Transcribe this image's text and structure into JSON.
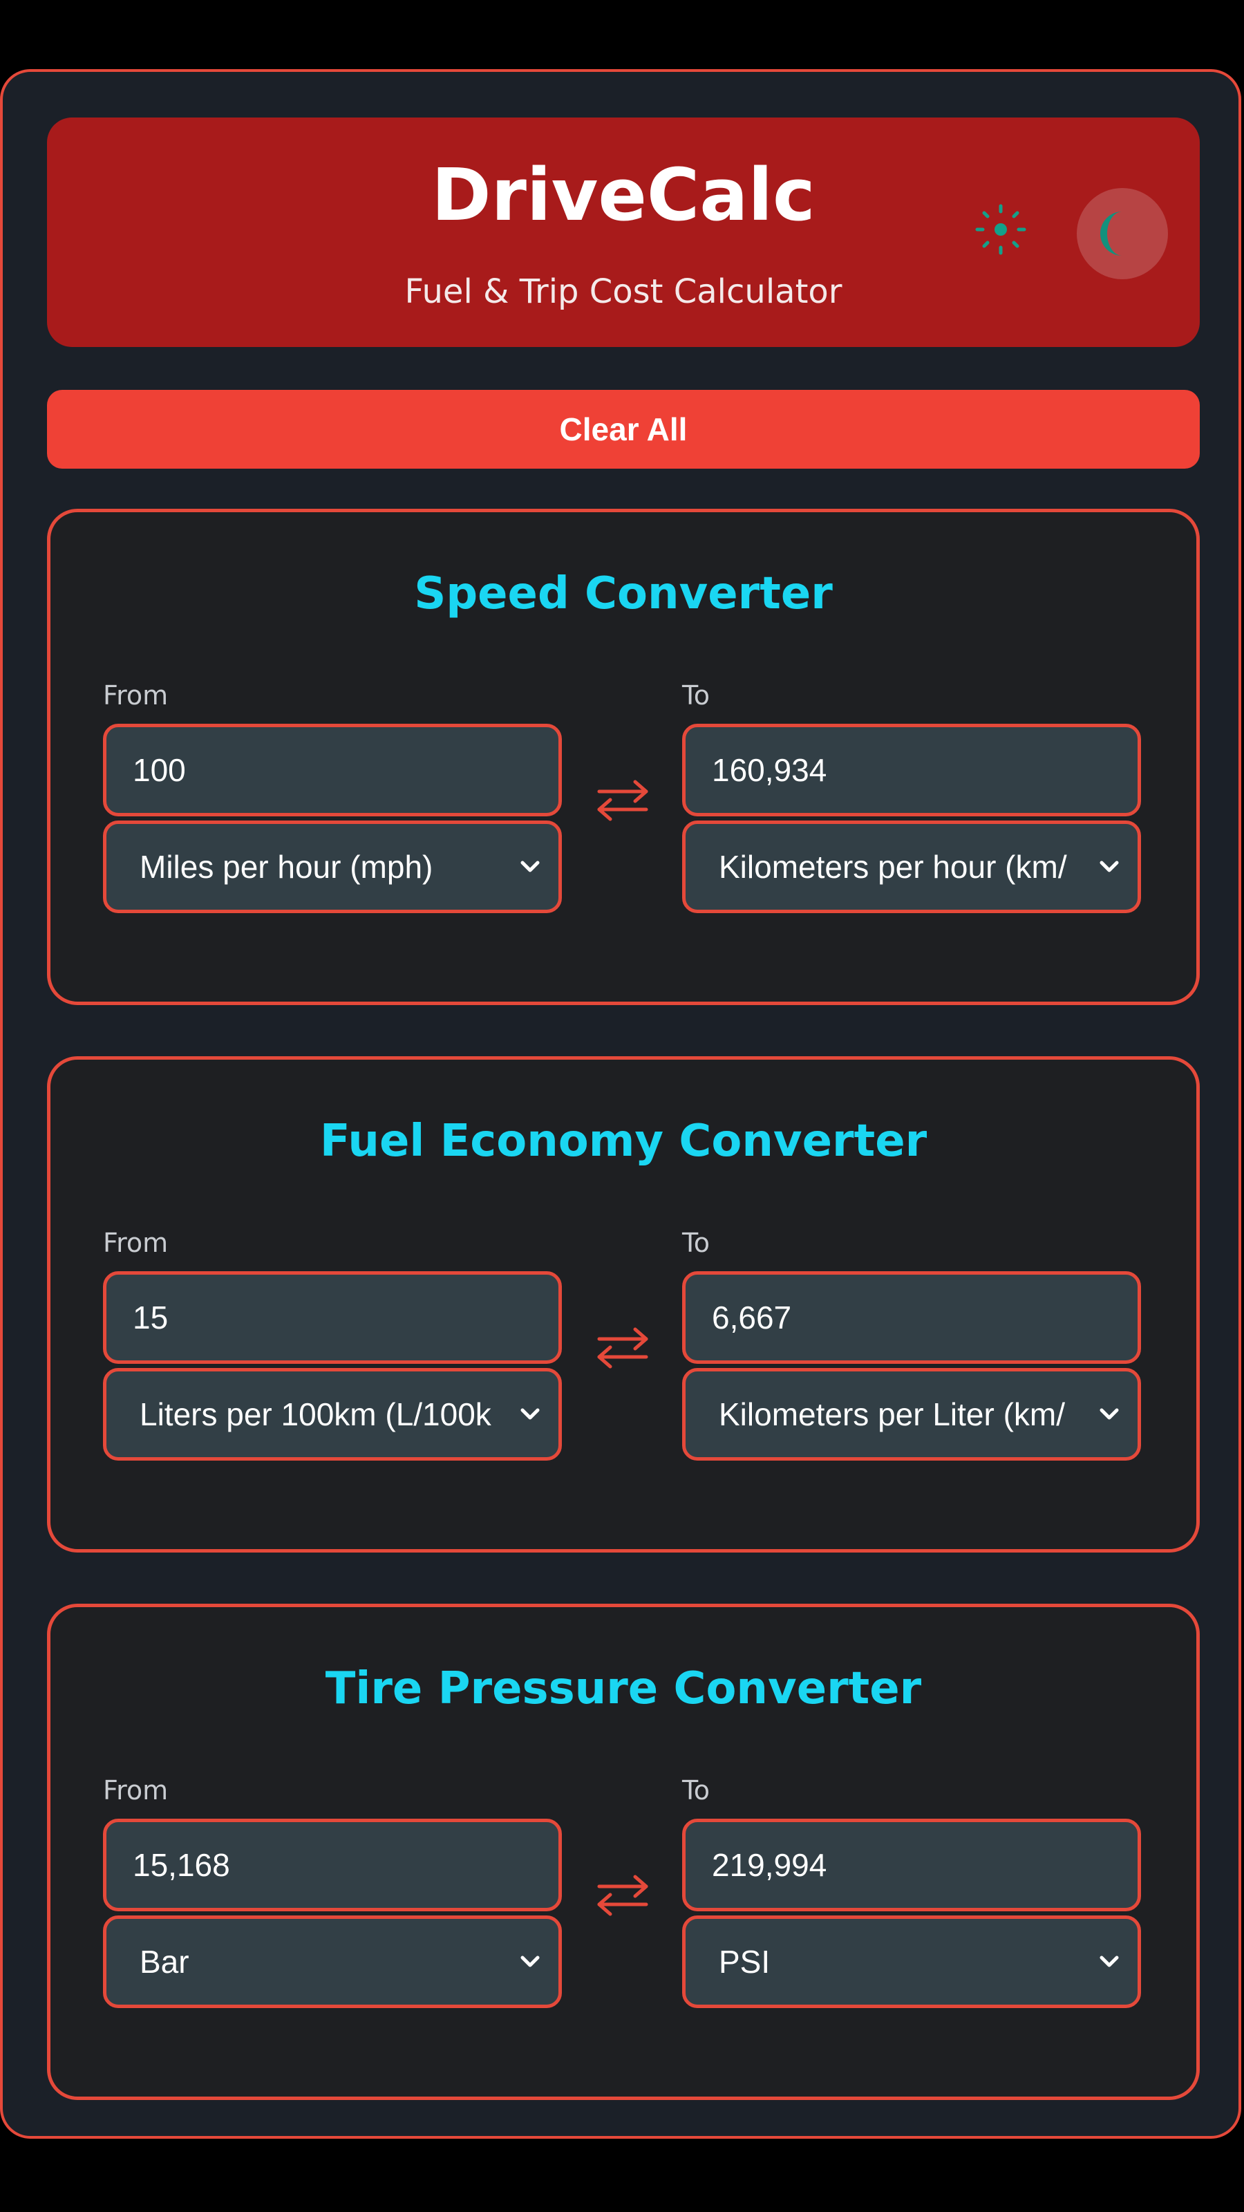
{
  "header": {
    "title": "DriveCalc",
    "subtitle": "Fuel & Trip Cost Calculator"
  },
  "actions": {
    "clear_all_label": "Clear All"
  },
  "converters": [
    {
      "title": "Speed Converter",
      "from_label": "From",
      "to_label": "To",
      "from_value": "100",
      "to_value": "160,934",
      "from_unit": "Miles per hour (mph)",
      "to_unit": "Kilometers per hour (km/"
    },
    {
      "title": "Fuel Economy Converter",
      "from_label": "From",
      "to_label": "To",
      "from_value": "15",
      "to_value": "6,667",
      "from_unit": "Liters per 100km (L/100k",
      "to_unit": "Kilometers per Liter (km/"
    },
    {
      "title": "Tire Pressure Converter",
      "from_label": "From",
      "to_label": "To",
      "from_value": "15,168",
      "to_value": "219,994",
      "from_unit": "Bar",
      "to_unit": "PSI"
    }
  ],
  "icons": {
    "theme_sun": "sun-icon",
    "theme_toggle": "moon-icon",
    "swap": "swap-arrows-icon",
    "select_caret": "chevron-down-icon"
  },
  "colors": {
    "page_background": "#1b2028",
    "header_background": "#a81b1b",
    "accent_red": "#ef4136",
    "border_red": "#e5493a",
    "card_title_cyan": "#1ad6f2",
    "field_background": "#323f46",
    "sun_teal": "#14a08a"
  }
}
